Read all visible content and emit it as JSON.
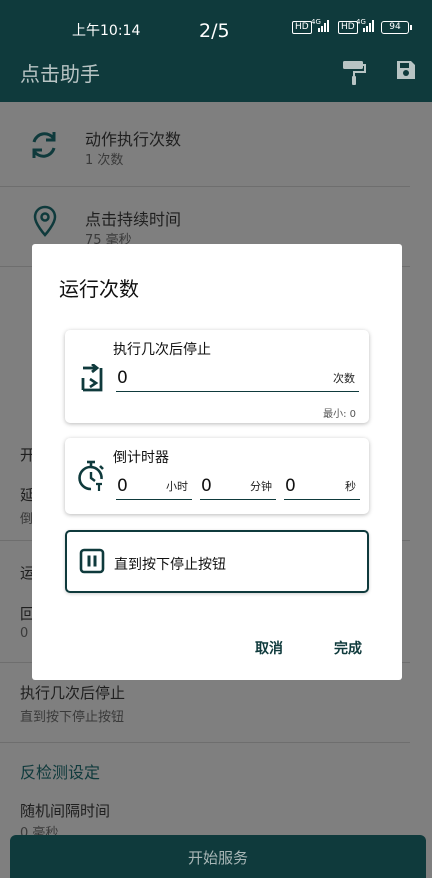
{
  "status_bar": {
    "time": "上午10:14",
    "page_indicator": "2/5",
    "signal_badge_1": "HD",
    "signal_label_1": "4G",
    "signal_badge_2": "HD",
    "signal_label_2": "4G",
    "battery": "94"
  },
  "app_bar": {
    "title": "点击助手",
    "icons": [
      "paint-roller-icon",
      "save-icon"
    ]
  },
  "background_list": {
    "items": [
      {
        "title": "动作执行次数",
        "subtitle": "1 次数",
        "icon": "sync-icon"
      },
      {
        "title": "点击持续时间",
        "subtitle": "75 毫秒",
        "icon": "location-pin-icon"
      }
    ],
    "partial_texts": {
      "sect_open": "开",
      "line_yan": "延",
      "line_dao": "倒",
      "sect_yun": "运",
      "line_hui": "回",
      "line_zero": "0"
    },
    "stop_after": {
      "title": "执行几次后停止",
      "subtitle": "直到按下停止按钮"
    },
    "anti_detect": {
      "section": "反检测设定",
      "title": "随机间隔时间",
      "subtitle": "0 毫秒"
    }
  },
  "start_button": {
    "label": "开始服务"
  },
  "dialog": {
    "title": "运行次数",
    "stop_after_card": {
      "label": "执行几次后停止",
      "value": "0",
      "unit": "次数",
      "min_hint": "最小: 0",
      "icon": "repeat-icon"
    },
    "countdown_card": {
      "label": "倒计时器",
      "icon": "stopwatch-icon",
      "hours": {
        "value": "0",
        "unit": "小时"
      },
      "minutes": {
        "value": "0",
        "unit": "分钟"
      },
      "seconds": {
        "value": "0",
        "unit": "秒"
      }
    },
    "until_stop_card": {
      "label": "直到按下停止按钮",
      "icon": "pause-icon",
      "selected": true
    },
    "cancel_label": "取消",
    "done_label": "完成"
  },
  "colors": {
    "accent": "#0f3a3c",
    "scrim_background": "#7f7f7f",
    "dialog_background": "#ffffff"
  }
}
